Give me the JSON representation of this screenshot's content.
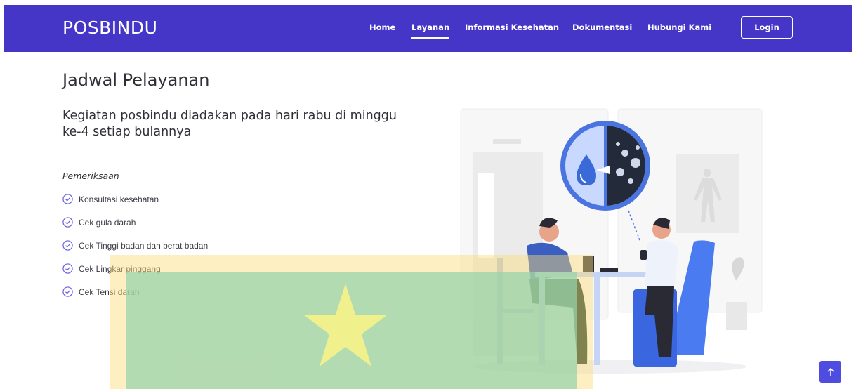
{
  "navbar": {
    "brand": "POSBINDU",
    "links": [
      {
        "label": "Home",
        "active": false
      },
      {
        "label": "Layanan",
        "active": true
      },
      {
        "label": "Informasi Kesehatan",
        "active": false
      },
      {
        "label": "Dokumentasi",
        "active": false
      },
      {
        "label": "Hubungi Kami",
        "active": false
      }
    ],
    "login_label": "Login"
  },
  "main": {
    "title": "Jadwal Pelayanan",
    "subtitle": "Kegiatan posbindu diadakan pada hari rabu di minggu ke-4 setiap bulannya",
    "exam_label": "Pemeriksaan",
    "exam_items": [
      "Konsultasi kesehatan",
      "Cek gula darah",
      "Cek Tinggi badan dan berat badan",
      "Cek Lingkar pinggang",
      "Cek Tensi darah"
    ]
  },
  "colors": {
    "navbar_bg": "#4536c7",
    "accent": "#4f4de0",
    "check_icon": "#6a5fe0"
  },
  "icons": {
    "check": "check-circle-icon",
    "back_to_top": "arrow-up-icon",
    "overlay": "star-flag-icon"
  }
}
